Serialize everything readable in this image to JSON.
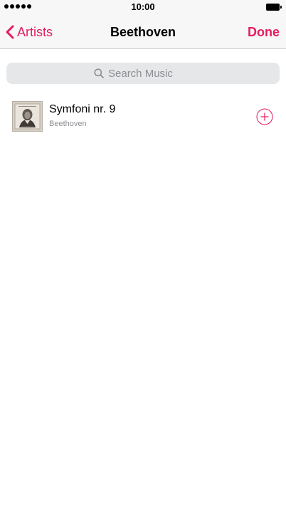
{
  "status_bar": {
    "time": "10:00"
  },
  "nav": {
    "back_label": "Artists",
    "title": "Beethoven",
    "done_label": "Done"
  },
  "search": {
    "placeholder": "Search Music",
    "value": ""
  },
  "songs": [
    {
      "title": "Symfoni nr. 9",
      "artist": "Beethoven"
    }
  ],
  "colors": {
    "accent": "#e51c5d",
    "bar_background": "#f7f7f7",
    "search_background": "#e6e7e9",
    "secondary_text": "#8e8e93"
  },
  "icons": {
    "back": "chevron-left-icon",
    "search": "search-icon",
    "add": "plus-circle-icon",
    "battery": "battery-icon",
    "signal": "signal-dots-icon"
  }
}
